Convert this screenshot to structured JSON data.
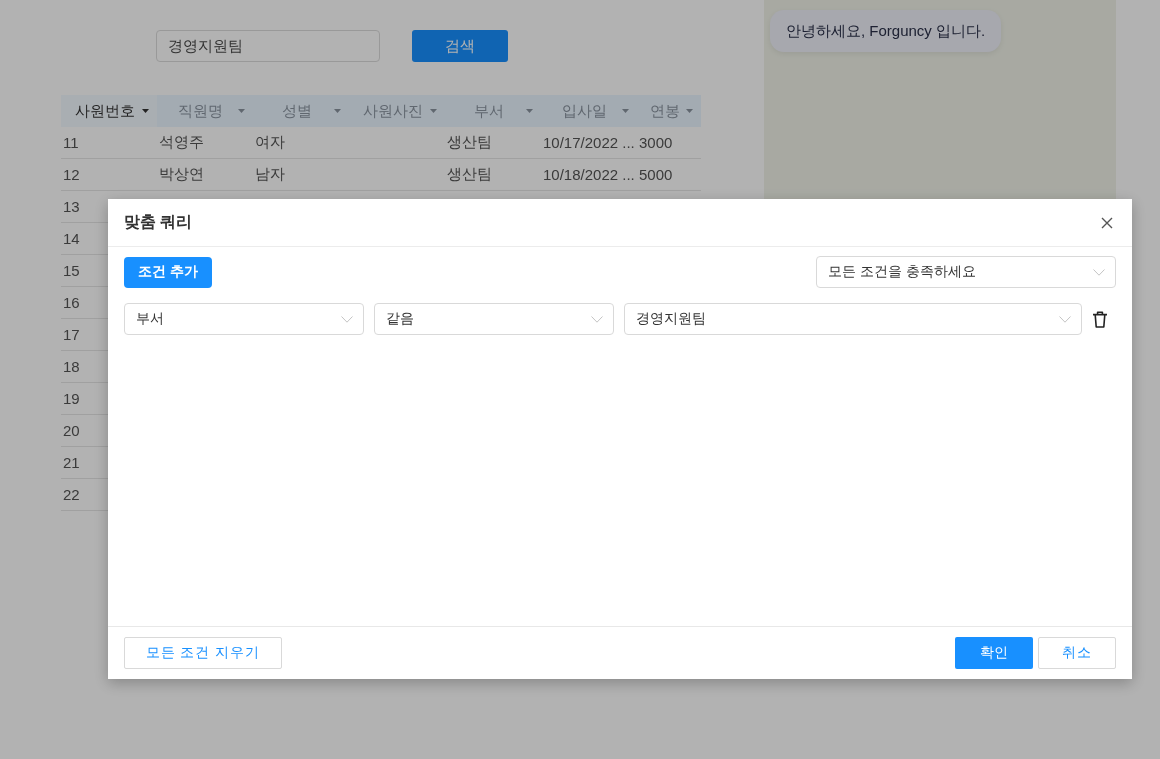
{
  "search": {
    "value": "경영지원팀",
    "button": "검색"
  },
  "chat": {
    "message": "안녕하세요, Forguncy 입니다."
  },
  "table": {
    "columns": [
      {
        "label": "사원번호",
        "selected": true
      },
      {
        "label": "직원명",
        "selected": false
      },
      {
        "label": "성별",
        "selected": false
      },
      {
        "label": "사원사진",
        "selected": false
      },
      {
        "label": "부서",
        "selected": false
      },
      {
        "label": "입사일",
        "selected": false
      },
      {
        "label": "연봉",
        "selected": false
      }
    ],
    "rows": [
      {
        "employee_no": "11",
        "name": "석영주",
        "gender": "여자",
        "department": "생산팀",
        "hire_date": "10/17/2022 ...",
        "salary": "3000"
      },
      {
        "employee_no": "12",
        "name": "박상연",
        "gender": "남자",
        "department": "생산팀",
        "hire_date": "10/18/2022 ...",
        "salary": "5000"
      },
      {
        "employee_no": "13"
      },
      {
        "employee_no": "14"
      },
      {
        "employee_no": "15"
      },
      {
        "employee_no": "16"
      },
      {
        "employee_no": "17"
      },
      {
        "employee_no": "18"
      },
      {
        "employee_no": "19"
      },
      {
        "employee_no": "20"
      },
      {
        "employee_no": "21"
      },
      {
        "employee_no": "22"
      }
    ]
  },
  "dialog": {
    "title": "맞춤 쿼리",
    "add_button": "조건 추가",
    "match_mode": "모든 조건을 충족하세요",
    "conditions": [
      {
        "field": "부서",
        "operator": "같음",
        "value": "경영지원팀"
      }
    ],
    "footer": {
      "clear_button": "모든 조건 지우기",
      "ok_button": "확인",
      "cancel_button": "취소"
    }
  }
}
